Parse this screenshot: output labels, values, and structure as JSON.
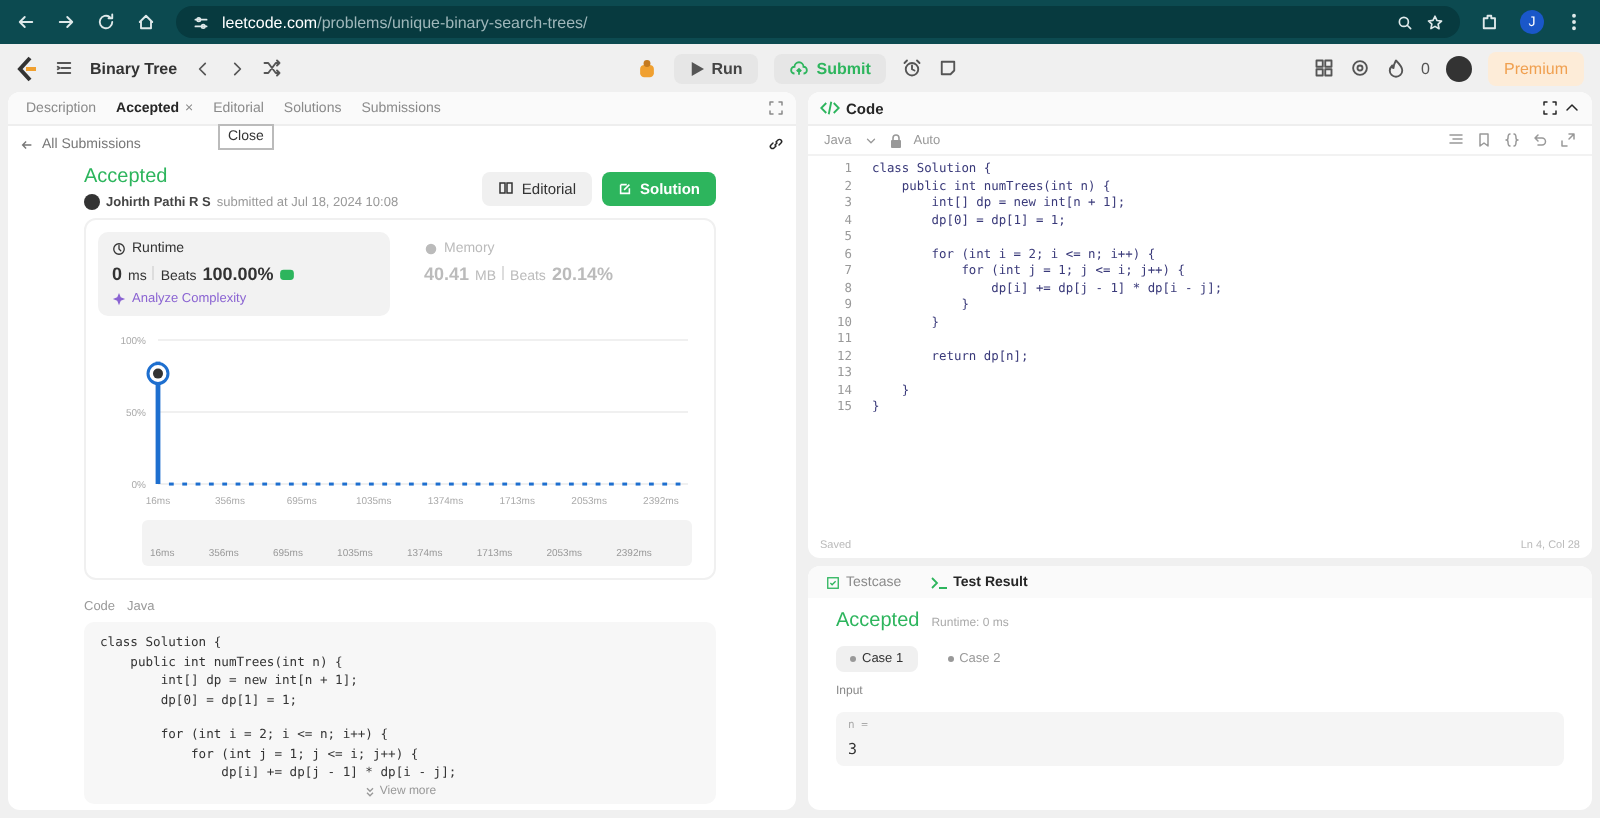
{
  "browser": {
    "url_host": "leetcode.com",
    "url_path": "/problems/unique-binary-search-trees/",
    "profile_initial": "J"
  },
  "toolbar": {
    "problem_list": "Binary Tree",
    "run": "Run",
    "submit": "Submit",
    "streak": "0",
    "premium": "Premium"
  },
  "left_tabs": [
    {
      "label": "Description",
      "selected": false
    },
    {
      "label": "Accepted",
      "selected": true,
      "close": "×"
    },
    {
      "label": "Editorial",
      "selected": false
    },
    {
      "label": "Solutions",
      "selected": false
    },
    {
      "label": "Submissions",
      "selected": false
    }
  ],
  "tooltip": "Close",
  "back_link": "All Submissions",
  "submission": {
    "status": "Accepted",
    "author": "Johirth Pathi R S",
    "submitted": "submitted at Jul 18, 2024 10:08",
    "buttons": [
      {
        "label": "Editorial",
        "kind": "secondary"
      },
      {
        "label": "Solution",
        "kind": "primary"
      }
    ]
  },
  "metrics": [
    {
      "label": "Runtime",
      "value": "0",
      "unit": "ms",
      "beats_label": "Beats",
      "beats": "100.00%",
      "selected": true,
      "link": "Analyze Complexity"
    },
    {
      "label": "Memory",
      "value": "40.41",
      "unit": "MB",
      "beats_label": "Beats",
      "beats": "20.14%",
      "selected": false
    }
  ],
  "distribution": {
    "chart_data": {
      "type": "bar",
      "x": [
        16,
        79,
        142,
        205,
        268,
        331,
        394,
        457,
        520,
        583,
        646,
        709,
        772,
        835,
        898,
        961,
        1024,
        1087,
        1150,
        1213,
        1276,
        1339,
        1402,
        1465,
        1528,
        1591,
        1654,
        1717,
        1780,
        1843,
        1906,
        1969,
        2032,
        2095,
        2158,
        2221,
        2284,
        2347,
        2410,
        2473
      ],
      "series": [
        {
          "color": "#1e6fcf",
          "values": [
            85,
            1,
            1,
            1,
            1,
            1,
            1,
            1,
            1,
            1,
            1,
            1,
            1,
            1,
            1,
            1,
            1,
            1,
            1,
            1,
            1,
            1,
            1,
            1,
            1,
            1,
            1,
            1,
            1,
            1,
            1,
            1,
            1,
            1,
            1,
            1,
            1,
            1,
            1,
            1
          ]
        }
      ],
      "xlim": [
        16,
        2520
      ],
      "ylim": [
        0,
        100
      ],
      "xticks": [
        {
          "value": 16,
          "label": "16ms"
        },
        {
          "value": 356,
          "label": "356ms"
        },
        {
          "value": 695,
          "label": "695ms"
        },
        {
          "value": 1035,
          "label": "1035ms"
        },
        {
          "value": 1374,
          "label": "1374ms"
        },
        {
          "value": 1713,
          "label": "1713ms"
        },
        {
          "value": 2053,
          "label": "2053ms"
        },
        {
          "value": 2392,
          "label": "2392ms"
        }
      ],
      "yticks": [
        {
          "value": 0,
          "label": "0%"
        },
        {
          "value": 50,
          "label": "50%"
        },
        {
          "value": 100,
          "label": "100%"
        }
      ]
    },
    "range_labels": [
      "16ms",
      "356ms",
      "695ms",
      "1035ms",
      "1374ms",
      "1713ms",
      "2053ms",
      "2392ms"
    ]
  },
  "code_preview": {
    "crumbs": [
      "Code",
      "Java"
    ],
    "blocks": [
      [
        "class Solution {",
        "    public int numTrees(int n) {",
        "        int[] dp = new int[n + 1];",
        "        dp[0] = dp[1] = 1;"
      ],
      [
        "        for (int i = 2; i <= n; i++) {",
        "            for (int j = 1; j <= i; j++) {",
        "                dp[i] += dp[j - 1] * dp[i - j];"
      ]
    ],
    "more": "View more"
  },
  "editor": {
    "title": "Code",
    "language": "Java",
    "mode": "Auto",
    "lines": [
      {
        "no": "1",
        "text": "class Solution {"
      },
      {
        "no": "2",
        "text": "    public int numTrees(int n) {"
      },
      {
        "no": "3",
        "text": "        int[] dp = new int[n + 1];"
      },
      {
        "no": "4",
        "text": "        dp[0] = dp[1] = 1;"
      },
      {
        "no": "5"
      },
      {
        "no": "6",
        "text": "        for (int i = 2; i <= n; i++) {"
      },
      {
        "no": "7",
        "text": "            for (int j = 1; j <= i; j++) {"
      },
      {
        "no": "8",
        "text": "                dp[i] += dp[j - 1] * dp[i - j];"
      },
      {
        "no": "9",
        "text": "            }"
      },
      {
        "no": "10",
        "text": "        }"
      },
      {
        "no": "11"
      },
      {
        "no": "12",
        "text": "        return dp[n];"
      },
      {
        "no": "13"
      },
      {
        "no": "14",
        "text": "    }"
      },
      {
        "no": "15",
        "text": "}"
      }
    ],
    "status_left": "Saved",
    "status_right": "Ln 4, Col 28"
  },
  "result": {
    "tabs": [
      {
        "label": "Testcase",
        "selected": false
      },
      {
        "label": "Test Result",
        "selected": true
      }
    ],
    "status": "Accepted",
    "runtime": "Runtime: 0 ms",
    "cases": [
      {
        "label": "Case 1",
        "selected": true
      },
      {
        "label": "Case 2",
        "selected": false
      }
    ],
    "input_label": "Input",
    "param": "n =",
    "value": "3"
  }
}
